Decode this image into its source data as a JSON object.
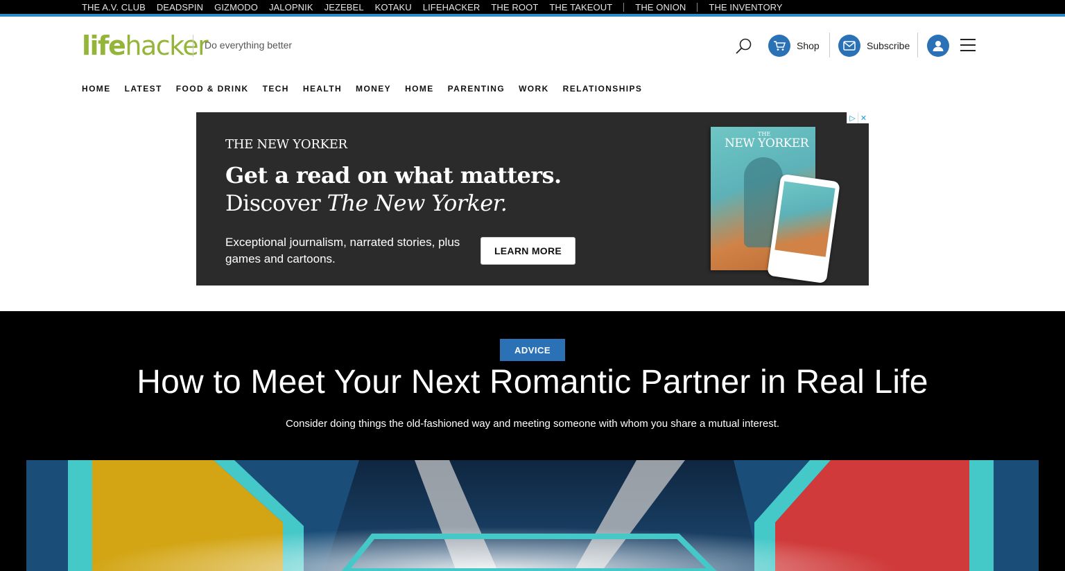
{
  "network": {
    "links": [
      "THE A.V. CLUB",
      "DEADSPIN",
      "GIZMODO",
      "JALOPNIK",
      "JEZEBEL",
      "KOTAKU",
      "LIFEHACKER",
      "THE ROOT",
      "THE TAKEOUT"
    ],
    "extra": [
      "THE ONION",
      "THE INVENTORY"
    ]
  },
  "header": {
    "logo_left": "life",
    "logo_right": "hacker",
    "tagline": "Do everything better",
    "shop_label": "Shop",
    "subscribe_label": "Subscribe"
  },
  "nav": [
    "HOME",
    "LATEST",
    "FOOD & DRINK",
    "TECH",
    "HEALTH",
    "MONEY",
    "HOME",
    "PARENTING",
    "WORK",
    "RELATIONSHIPS"
  ],
  "ad": {
    "brand": "THE NEW YORKER",
    "headline1": "Get a read on what matters.",
    "headline2_prefix": "Discover ",
    "headline2_italic": "The New Yorker.",
    "subtext": "Exceptional journalism, narrated stories, plus games and cartoons.",
    "button": "LEARN MORE",
    "magazine_title": "NEW YORKER",
    "magazine_the": "THE"
  },
  "article": {
    "category": "ADVICE",
    "title": "How to Meet Your Next Romantic Partner in Real Life",
    "subtitle": "Consider doing things the old-fashioned way and meeting someone with whom you share a mutual interest."
  },
  "colors": {
    "brand_green": "#94b53a",
    "accent_blue": "#2a72b5",
    "network_border": "#2a8bc9"
  }
}
